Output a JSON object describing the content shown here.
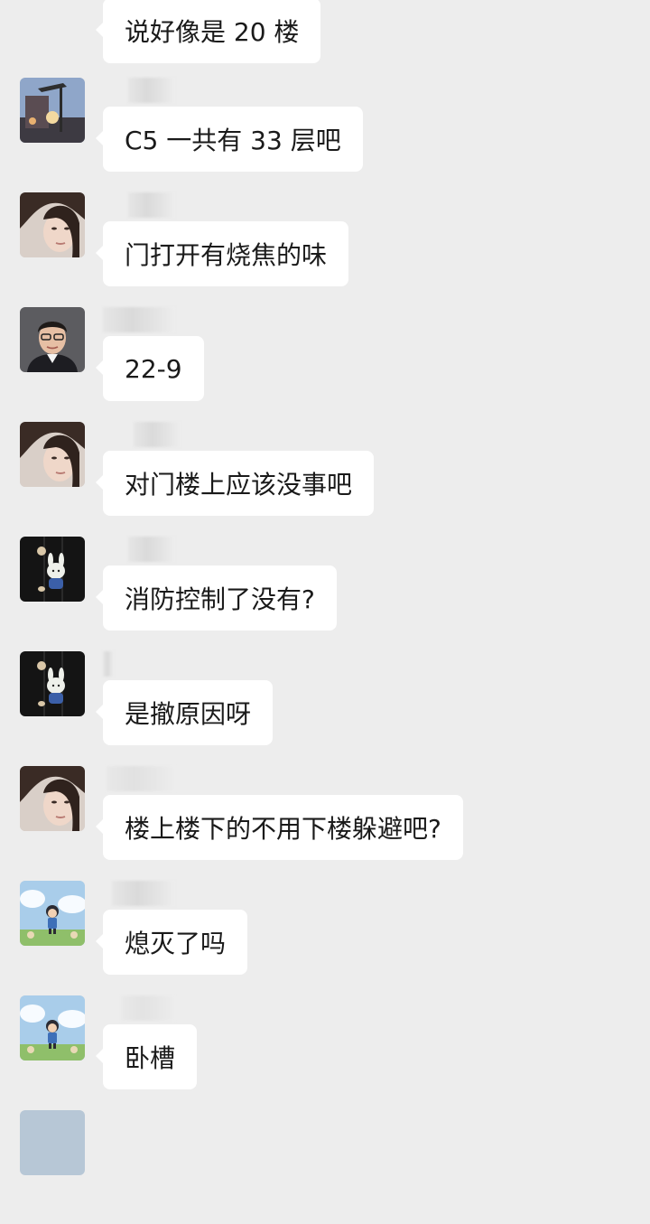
{
  "messages": [
    {
      "avatar": "latte-art-avatar",
      "text": "说好像是 20 楼"
    },
    {
      "avatar": "street-lamp-avatar",
      "text": "C5 一共有 33 层吧"
    },
    {
      "avatar": "woman-portrait-avatar",
      "sender_partial": "",
      "text": "门打开有烧焦的味"
    },
    {
      "avatar": "man-glasses-avatar",
      "text": "22-9"
    },
    {
      "avatar": "woman-portrait-avatar",
      "sender_partial": "",
      "text": "对门楼上应该没事吧"
    },
    {
      "avatar": "plush-bunny-avatar",
      "sender_partial": "",
      "text": "消防控制了没有?"
    },
    {
      "avatar": "plush-bunny-avatar",
      "sender_partial": "",
      "text": "是撤原因呀"
    },
    {
      "avatar": "woman-portrait-avatar",
      "text": "楼上楼下的不用下楼躲避吧?"
    },
    {
      "avatar": "cartoon-kid-avatar",
      "text": "熄灭了吗"
    },
    {
      "avatar": "cartoon-kid-avatar",
      "sender_partial": "",
      "text": "卧槽"
    }
  ],
  "colors": {
    "background": "#ededed",
    "bubble": "#ffffff",
    "text": "#1a1a1a"
  }
}
